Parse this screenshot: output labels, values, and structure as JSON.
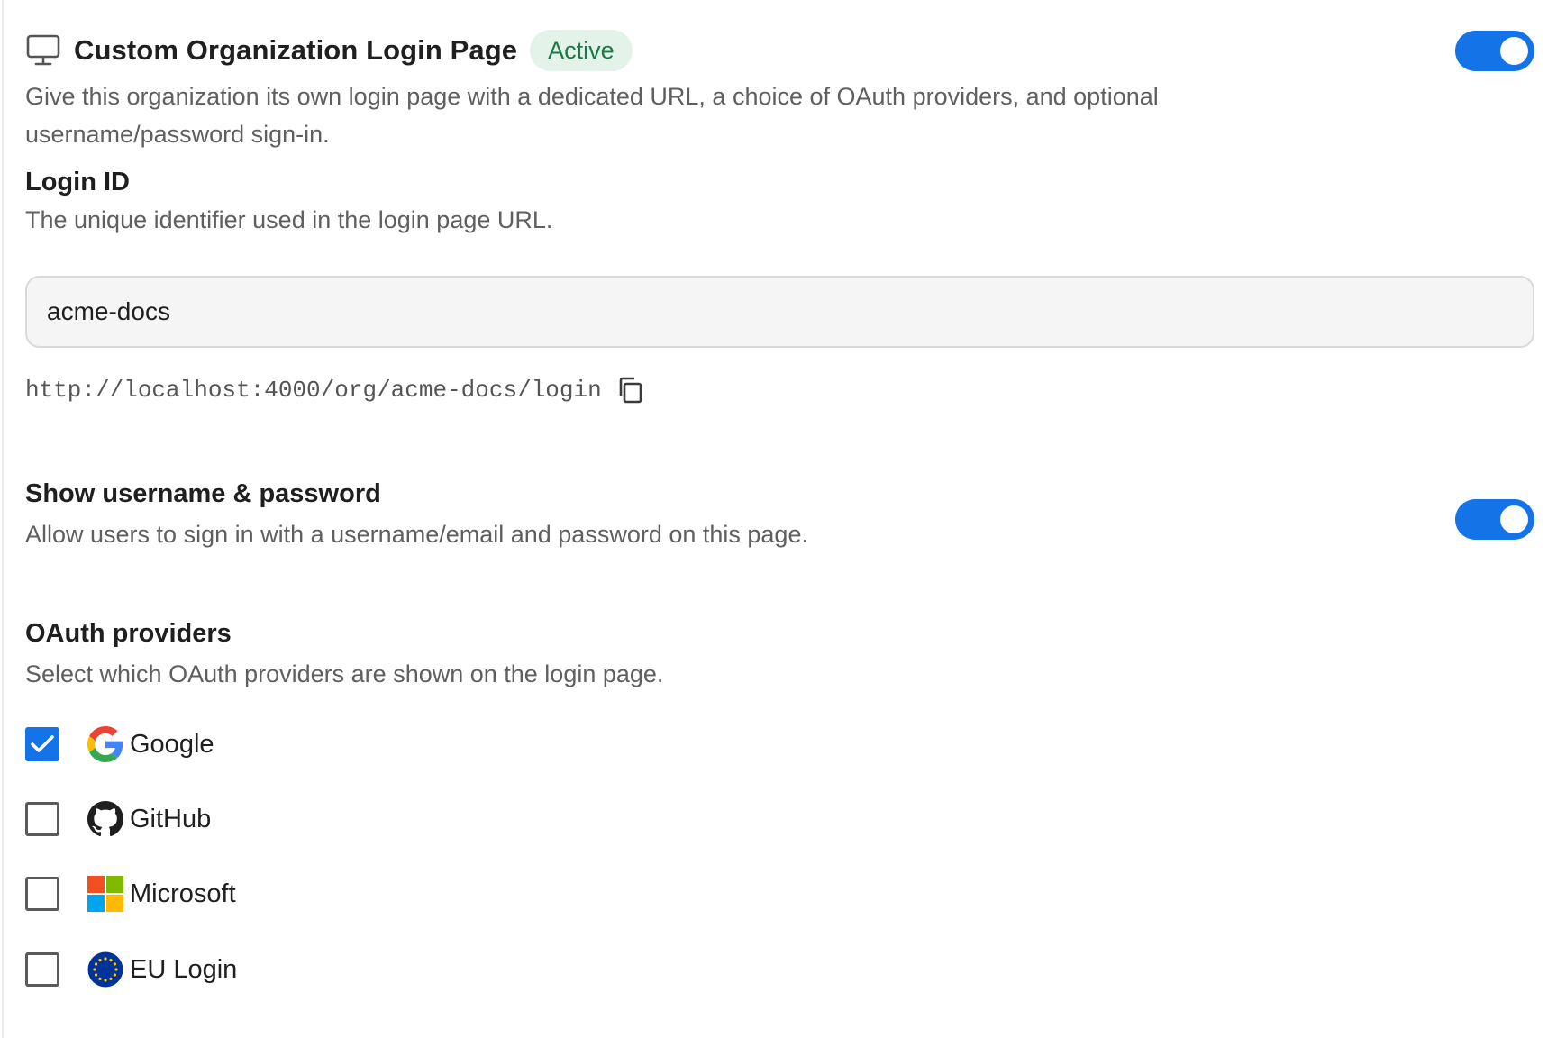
{
  "header": {
    "title": "Custom Organization Login Page",
    "status_badge": "Active",
    "enabled": true,
    "description": "Give this organization its own login page with a dedicated URL, a choice of OAuth providers, and optional username/password sign-in."
  },
  "login_id": {
    "label": "Login ID",
    "help": "The unique identifier used in the login page URL.",
    "value": "acme-docs",
    "url": "http://localhost:4000/org/acme-docs/login"
  },
  "username_password": {
    "label": "Show username & password",
    "help": "Allow users to sign in with a username/email and password on this page.",
    "enabled": true
  },
  "oauth": {
    "label": "OAuth providers",
    "help": "Select which OAuth providers are shown on the login page.",
    "providers": [
      {
        "name": "Google",
        "icon": "google-icon",
        "checked": true
      },
      {
        "name": "GitHub",
        "icon": "github-icon",
        "checked": false
      },
      {
        "name": "Microsoft",
        "icon": "microsoft-icon",
        "checked": false
      },
      {
        "name": "EU Login",
        "icon": "eu-flag-icon",
        "checked": false
      }
    ]
  },
  "colors": {
    "accent": "#1473e6",
    "badge_bg": "#e3f3ea",
    "badge_text": "#1b7a45"
  }
}
